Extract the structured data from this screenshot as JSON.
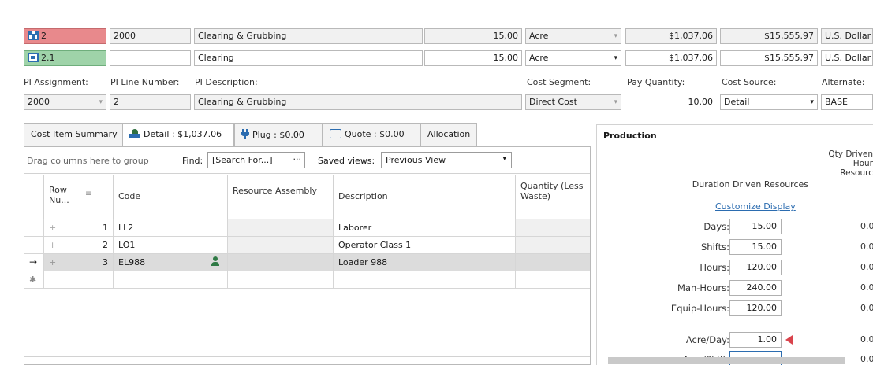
{
  "top_rows": [
    {
      "icon": "assembly-icon",
      "id": "2",
      "pi": "2000",
      "desc": "Clearing & Grubbing",
      "qty": "15.00",
      "unit": "Acre",
      "unit_cost": "$1,037.06",
      "total": "$15,555.97",
      "currency": "U.S. Dollar"
    },
    {
      "icon": "item-icon",
      "id": "2.1",
      "pi": "",
      "desc": "Clearing",
      "qty": "15.00",
      "unit": "Acre",
      "unit_cost": "$1,037.06",
      "total": "$15,555.97",
      "currency": "U.S. Dollar"
    }
  ],
  "labels": {
    "pi_assignment": "PI Assignment:",
    "pi_line_number": "PI Line Number:",
    "pi_description": "PI Description:",
    "cost_segment": "Cost Segment:",
    "pay_quantity": "Pay Quantity:",
    "cost_source": "Cost Source:",
    "alternate": "Alternate:"
  },
  "values": {
    "pi_assignment": "2000",
    "pi_line_number": "2",
    "pi_description": "Clearing & Grubbing",
    "cost_segment": "Direct Cost",
    "pay_quantity": "10.00",
    "cost_source": "Detail",
    "alternate": "BASE"
  },
  "tabs": [
    {
      "label": "Cost Item Summary",
      "active": false
    },
    {
      "label": "Detail : $1,037.06",
      "active": true
    },
    {
      "label": "Plug : $0.00",
      "active": false
    },
    {
      "label": "Quote : $0.00",
      "active": false
    },
    {
      "label": "Allocation",
      "active": false
    }
  ],
  "toolbar": {
    "group_hint": "Drag columns here to group",
    "find_label": "Find:",
    "find_placeholder": "[Search For...]",
    "find_more": "···",
    "saved_views_label": "Saved views:",
    "saved_view": "Previous View"
  },
  "grid": {
    "headers": [
      "Row Nu...",
      "Code",
      "Resource Assembly",
      "Description",
      "Quantity (Less Waste)"
    ],
    "rows": [
      {
        "row": "1",
        "code": "LL2",
        "assembly": "",
        "description": "Laborer",
        "qty": ""
      },
      {
        "row": "2",
        "code": "LO1",
        "assembly": "",
        "description": "Operator Class 1",
        "qty": ""
      },
      {
        "row": "3",
        "code": "EL988",
        "assembly": "",
        "description": "Loader 988",
        "qty": ""
      }
    ],
    "current_marker": "→",
    "new_marker": "✱",
    "expand_glyph": "+"
  },
  "production": {
    "title": "Production",
    "duration_header": "Duration Driven Resources",
    "qty_header": "Qty Driven Hour Resourc",
    "customize": "Customize Display",
    "fields": [
      {
        "label": "Days:",
        "value": "15.00",
        "right": "0.0"
      },
      {
        "label": "Shifts:",
        "value": "15.00",
        "right": "0.0"
      },
      {
        "label": "Hours:",
        "value": "120.00",
        "right": "0.0"
      },
      {
        "label": "Man-Hours:",
        "value": "240.00",
        "right": "0.0"
      },
      {
        "label": "Equip-Hours:",
        "value": "120.00",
        "right": "0.0"
      },
      {
        "label": "Acre/Day:",
        "value": "1.00",
        "right": "0.0"
      },
      {
        "label": "Acre/Shift:",
        "value": "",
        "right": "0.0"
      }
    ]
  },
  "colors": {
    "row1": "#e8898c",
    "row2": "#9fd3a9",
    "accent": "#2b6cb0",
    "marker": "#d9434c"
  }
}
